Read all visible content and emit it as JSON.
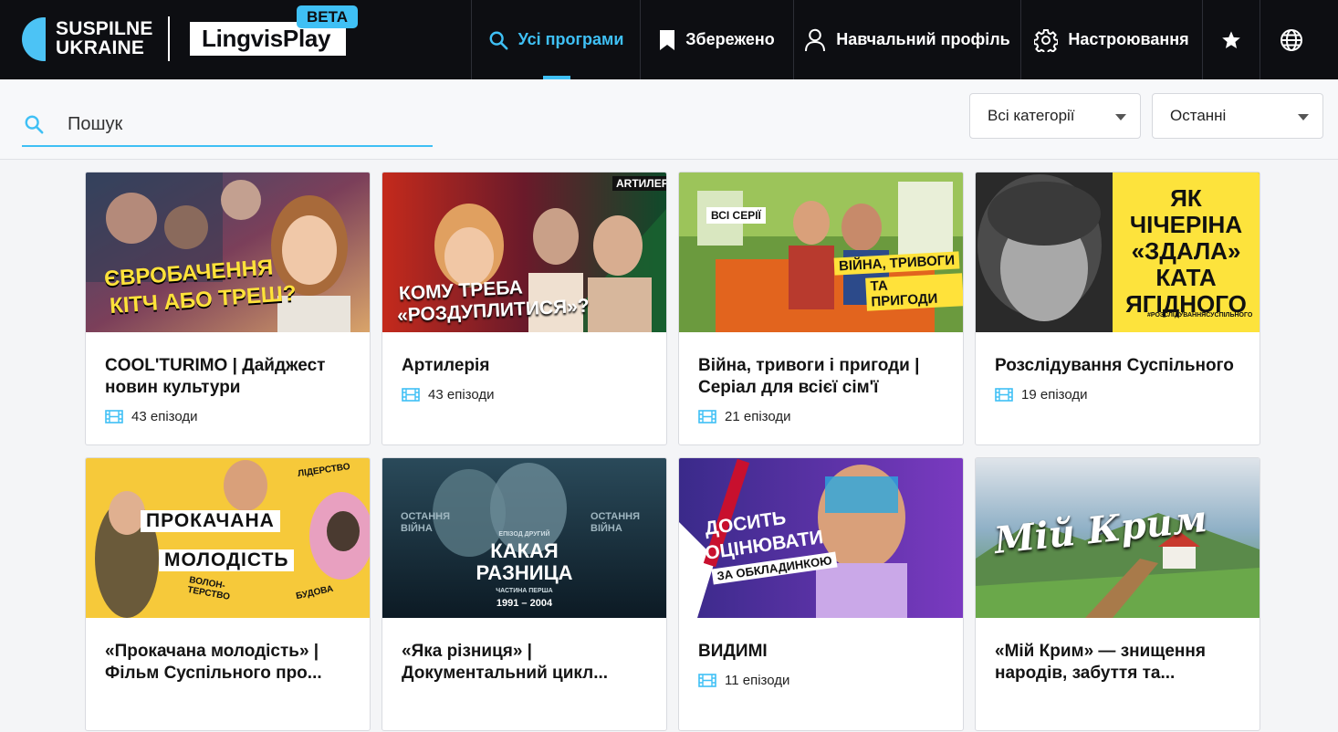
{
  "brand": {
    "line1": "SUSPILNE",
    "line2": "UKRAINE",
    "product": "LingvisPlay",
    "badge": "BETA"
  },
  "nav": [
    {
      "label": "Усі програми",
      "icon": "search-icon",
      "active": true
    },
    {
      "label": "Збережено",
      "icon": "bookmark-icon"
    },
    {
      "label": "Навчальний профіль",
      "icon": "user-icon"
    },
    {
      "label": "Настроювання",
      "icon": "gear-icon"
    },
    {
      "label": "",
      "icon": "star-icon"
    },
    {
      "label": "",
      "icon": "globe-icon"
    }
  ],
  "search": {
    "placeholder": "Пошук",
    "value": ""
  },
  "filters": {
    "category": "Всі категорії",
    "sort": "Останні"
  },
  "colors": {
    "accent": "#3fc0f5",
    "topbar": "#0d0e12"
  },
  "programs": [
    {
      "title": "COOL'TURIMO | Дайджест новин культури",
      "episodes": "43 епізоди",
      "thumb_text": [
        "ЄВРОБАЧЕННЯ",
        "КІТЧ АБО ТРЕШ?"
      ]
    },
    {
      "title": "Артилерія",
      "episodes": "43 епізоди",
      "thumb_text": [
        "КОМУ ТРЕБА",
        "«РОЗДУПЛИТИСЯ»?",
        "ARTИЛЕРІЯ"
      ]
    },
    {
      "title": "Війна, тривоги і пригоди | Серіал для всієї сім'ї",
      "episodes": "21 епізоди",
      "thumb_text": [
        "ВСІ СЕРІЇ",
        "ВІЙНА, ТРИВОГИ",
        "ТА ПРИГОДИ"
      ]
    },
    {
      "title": "Розслідування Суспільного",
      "episodes": "19 епізоди",
      "thumb_text": [
        "ЯК ЧІЧЕРІНА",
        "«ЗДАЛА»",
        "КАТА",
        "ЯГІДНОГО",
        "#РОЗСЛІДУВАННЯСУСПІЛЬНОГО"
      ]
    },
    {
      "title": "«Прокачана молодість» | Фільм Суспільного про...",
      "episodes": "",
      "thumb_text": [
        "ПРОКАЧАНА",
        "МОЛОДІСТЬ",
        "ЛІДЕРСТВО",
        "ВОЛОН-",
        "ТЕРСТВО",
        "БУДОВА"
      ]
    },
    {
      "title": "«Яка різниця» | Документальний цикл...",
      "episodes": "",
      "thumb_text": [
        "КАКАЯ",
        "РАЗНИЦА",
        "ЕПІЗОД ДРУГИЙ",
        "ЧАСТИНА ПЕРША",
        "1991 – 2004",
        "ОСТАННЯ",
        "ВІЙНА"
      ]
    },
    {
      "title": "ВИДИМІ",
      "episodes": "11 епізоди",
      "thumb_text": [
        "ДОСИТЬ",
        "ОЦІНЮВАТИ",
        "ЗА ОБКЛАДИНКОЮ"
      ]
    },
    {
      "title": "«Мій Крим» — знищення народів, забуття та...",
      "episodes": "",
      "thumb_text": [
        "Мій Крим"
      ]
    }
  ]
}
